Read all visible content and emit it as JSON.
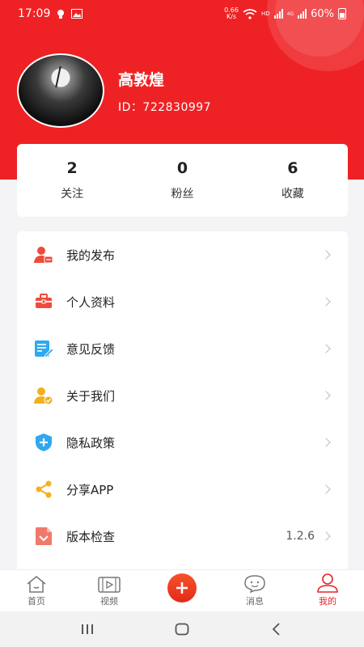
{
  "status": {
    "time": "17:09",
    "net_speed_top": "0.66",
    "net_speed_bottom": "K/s",
    "hd": "HD",
    "sig_label": "4G",
    "battery": "60%"
  },
  "profile": {
    "name": "高敦煌",
    "id": "ID：722830997"
  },
  "stats": [
    {
      "value": "2",
      "label": "关注"
    },
    {
      "value": "0",
      "label": "粉丝"
    },
    {
      "value": "6",
      "label": "收藏"
    }
  ],
  "menu": [
    {
      "label": "我的发布",
      "icon": "user-post-icon"
    },
    {
      "label": "个人资料",
      "icon": "toolbox-icon"
    },
    {
      "label": "意见反馈",
      "icon": "feedback-icon"
    },
    {
      "label": "关于我们",
      "icon": "about-us-icon"
    },
    {
      "label": "隐私政策",
      "icon": "shield-plus-icon"
    },
    {
      "label": "分享APP",
      "icon": "share-icon"
    },
    {
      "label": "版本检查",
      "icon": "version-icon",
      "value": "1.2.6"
    }
  ],
  "tabs": [
    {
      "label": "首页",
      "icon": "home-icon"
    },
    {
      "label": "视频",
      "icon": "video-icon"
    },
    {
      "label": "",
      "icon": "plus-icon"
    },
    {
      "label": "消息",
      "icon": "message-icon"
    },
    {
      "label": "我的",
      "icon": "user-icon",
      "active": true
    }
  ],
  "colors": {
    "accent": "#ee2224",
    "active_tab": "#e8202a"
  }
}
